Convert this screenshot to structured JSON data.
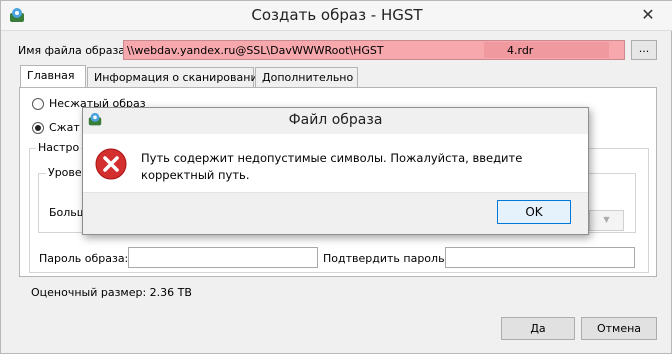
{
  "window": {
    "title": "Создать образ - HGST",
    "close_glyph": "✕"
  },
  "file_name": {
    "label": "Имя файла образа:",
    "path_value": "\\\\webdav.yandex.ru@SSL\\DavWWWRoot\\HGST",
    "path_suffix": "4.rdr",
    "browse_label": "..."
  },
  "tabs": [
    {
      "label": "Главная",
      "active": true
    },
    {
      "label": "Информация о сканировании",
      "active": false
    },
    {
      "label": "Дополнительно",
      "active": false
    }
  ],
  "main_tab": {
    "radio_uncompressed": "Несжатый образ",
    "radio_compressed": "Сжат",
    "group_settings": "Настро",
    "level_label": "Урове",
    "big_label": "Больш",
    "image_password_label": "Пароль образа:",
    "confirm_password_label": "Подтвердить пароль:"
  },
  "estimated_size": "Оценочный размер: 2.36 TB",
  "buttons": {
    "yes": "Да",
    "cancel": "Отмена"
  },
  "error_dialog": {
    "title": "Файл образа",
    "message": "Путь содержит недопустимые символы. Пожалуйста, введите корректный путь.",
    "ok": "OK"
  },
  "colors": {
    "invalid_field_bg": "#f7a8ad",
    "error_icon": "#d32f2f",
    "ok_button_border": "#0078d7"
  }
}
